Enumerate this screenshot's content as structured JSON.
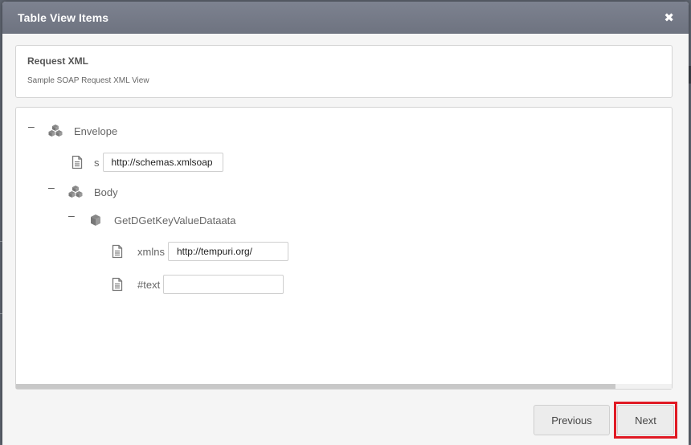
{
  "modal": {
    "title": "Table View Items",
    "close_symbol": "✖"
  },
  "request": {
    "title": "Request XML",
    "subtitle": "Sample SOAP Request XML View"
  },
  "tree": {
    "toggle_symbol": "–",
    "envelope": {
      "label": "Envelope"
    },
    "envelope_attr": {
      "label": "s",
      "value": "http://schemas.xmlsoap"
    },
    "body": {
      "label": "Body"
    },
    "method": {
      "label": "GetDGetKeyValueDataata"
    },
    "xmlns_attr": {
      "label": "xmlns",
      "value": "http://tempuri.org/"
    },
    "text_attr": {
      "label": "#text",
      "value": ""
    }
  },
  "buttons": {
    "previous": "Previous",
    "next": "Next"
  },
  "colors": {
    "header": "#737886",
    "highlight": "#e01a24"
  }
}
